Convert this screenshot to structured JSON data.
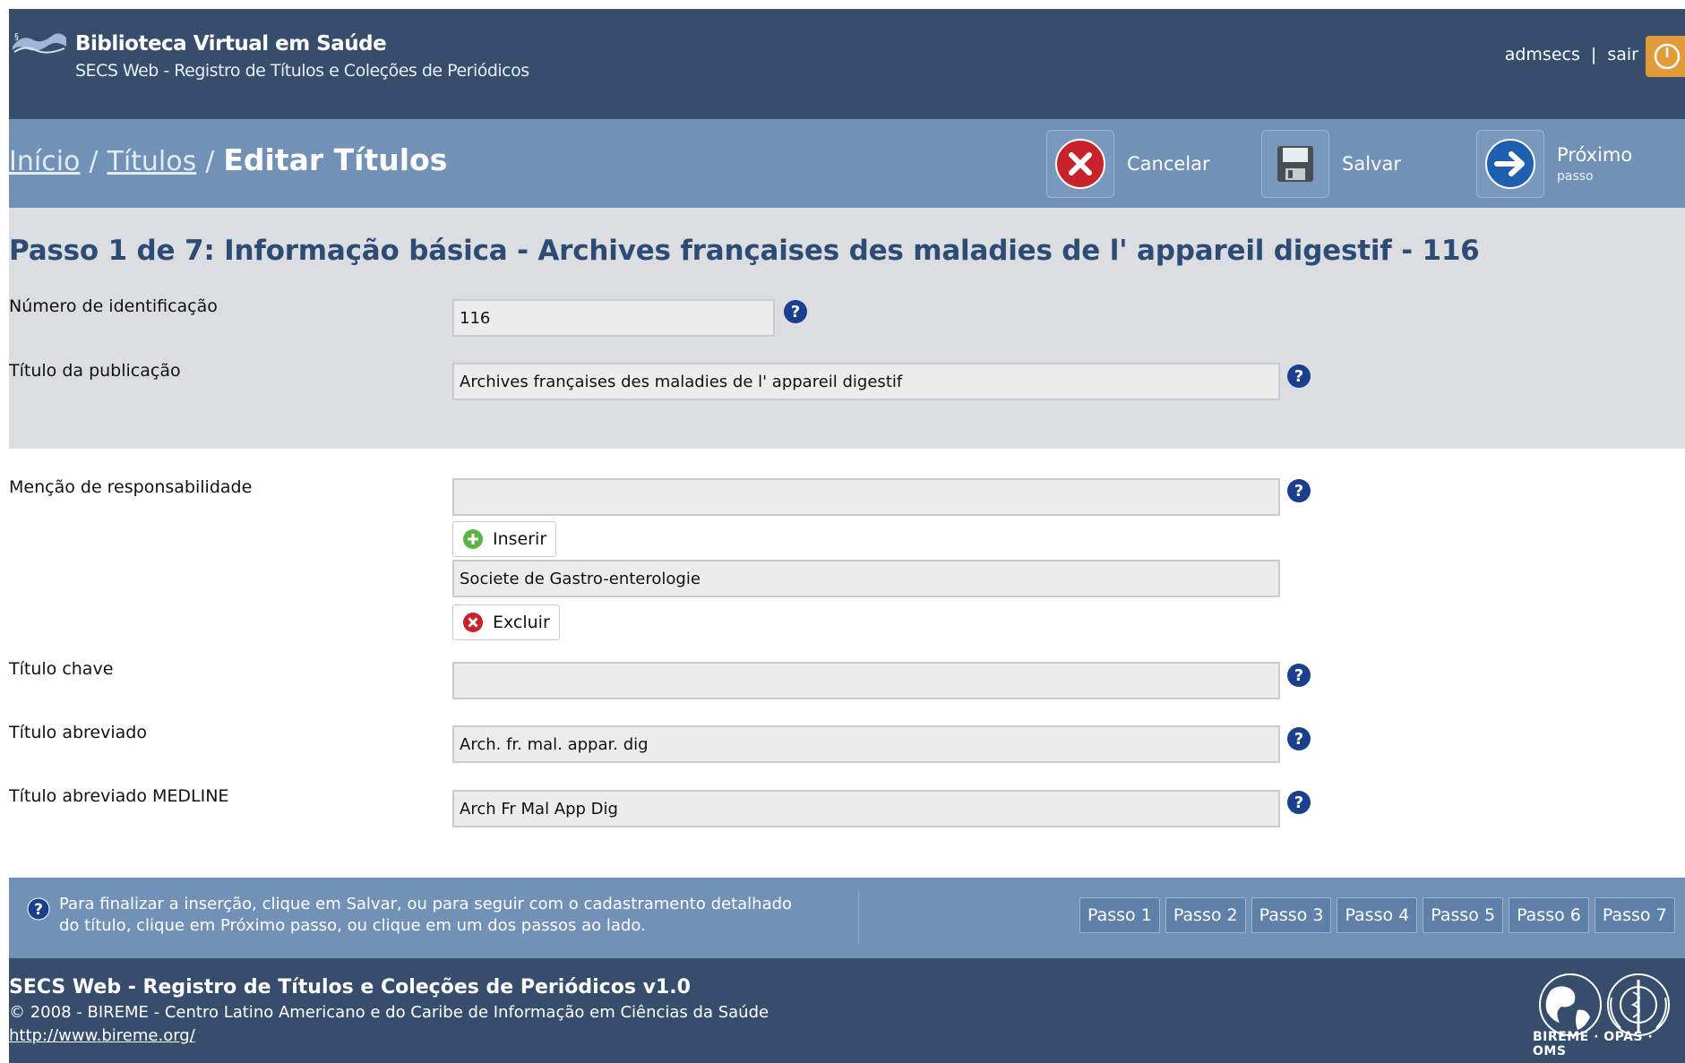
{
  "header": {
    "app_name": "Biblioteca Virtual em Saúde",
    "app_subtitle": "SECS Web - Registro de Títulos e Coleções de Periódicos",
    "username": "admsecs",
    "separator": "|",
    "logout_label": "sair"
  },
  "breadcrumb": {
    "home": "Início",
    "sep": "/",
    "titles": "Títulos",
    "current": "Editar Títulos"
  },
  "toolbar": {
    "cancel_label": "Cancelar",
    "save_label": "Salvar",
    "next_label": "Próximo",
    "next_sub": "passo"
  },
  "form": {
    "step_title": "Passo 1 de 7: Informação básica - Archives françaises des maladies de l' appareil digestif - 116",
    "id_label": "Número de identificação",
    "id_value": "116",
    "pub_title_label": "Título da publicação",
    "pub_title_value": "Archives françaises des maladies de l' appareil digestif",
    "resp_label": "Menção de responsabilidade",
    "resp_value": "",
    "insert_label": "Inserir",
    "resp_item": "Societe de Gastro-enterologie",
    "delete_label": "Excluir",
    "key_title_label": "Título chave",
    "key_title_value": "",
    "abbr_label": "Título abreviado",
    "abbr_value": "Arch. fr. mal. appar. dig",
    "medline_label": "Título abreviado MEDLINE",
    "medline_value": "Arch Fr Mal App Dig"
  },
  "info": {
    "line1": "Para finalizar a inserção, clique em Salvar, ou para seguir com o cadastramento detalhado",
    "line2": "do título, clique em Próximo passo, ou clique em um dos passos ao lado."
  },
  "steps": [
    "Passo 1",
    "Passo 2",
    "Passo 3",
    "Passo 4",
    "Passo 5",
    "Passo 6",
    "Passo 7"
  ],
  "footer": {
    "title": "SECS Web - Registro de Títulos e Coleções de Periódicos v1.0",
    "copyright": "© 2008 - BIREME - Centro Latino Americano e do Caribe de Informação em Ciências da Saúde",
    "link": "http://www.bireme.org/",
    "logo_text": "BIREME · OPAS · OMS"
  },
  "colors": {
    "header_bg": "#364d6b",
    "bar_bg": "#7291b6",
    "grey_band": "#dcdde1",
    "title_blue": "#2c4c76"
  }
}
